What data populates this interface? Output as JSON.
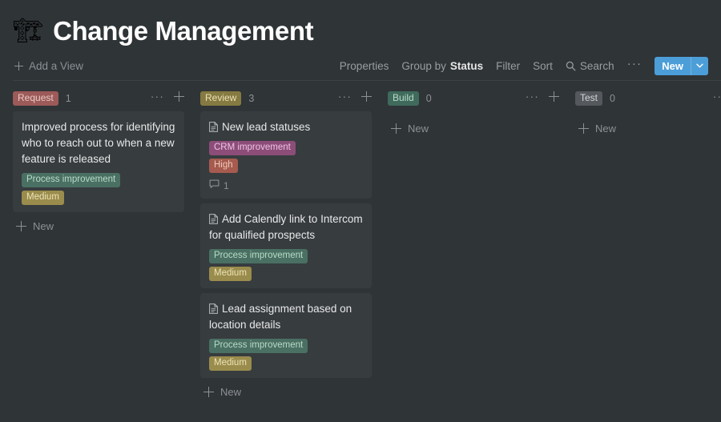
{
  "header": {
    "emoji": "🏗",
    "emoji_name": "crane-emoji",
    "title": "Change Management"
  },
  "toolbar": {
    "add_view_label": "Add a View",
    "properties_label": "Properties",
    "group_by_prefix": "Group by",
    "group_by_value": "Status",
    "filter_label": "Filter",
    "sort_label": "Sort",
    "search_label": "Search",
    "more_label": "···",
    "new_label": "New",
    "new_button_color": "#4c9ed9"
  },
  "board": {
    "columns": [
      {
        "name": "Request",
        "count": "1",
        "badge_bg": "#9c5a58",
        "badge_fg": "#e9c9c6",
        "new_label": "New",
        "cards": [
          {
            "title": "Improved process for identifying who to reach out to when a new feature is released",
            "has_doc_icon": false,
            "tags": [
              {
                "label": "Process improvement",
                "bg": "#4a7063",
                "fg": "#b9dbc9"
              },
              {
                "label": "Medium",
                "bg": "#9a8c4c",
                "fg": "#ece2b6"
              }
            ],
            "comments": ""
          }
        ]
      },
      {
        "name": "Review",
        "count": "3",
        "badge_bg": "#857a41",
        "badge_fg": "#ece2b6",
        "new_label": "New",
        "cards": [
          {
            "title": "New lead statuses",
            "has_doc_icon": true,
            "tags": [
              {
                "label": "CRM improvement",
                "bg": "#8c4d79",
                "fg": "#eec3e3"
              },
              {
                "label": "High",
                "bg": "#a65b4e",
                "fg": "#eec8bd"
              }
            ],
            "comments": "1"
          },
          {
            "title": "Add Calendly link to Intercom for qualified prospects",
            "has_doc_icon": true,
            "tags": [
              {
                "label": "Process improvement",
                "bg": "#4a7063",
                "fg": "#b9dbc9"
              },
              {
                "label": "Medium",
                "bg": "#9a8c4c",
                "fg": "#ece2b6"
              }
            ],
            "comments": ""
          },
          {
            "title": "Lead assignment based on location details",
            "has_doc_icon": true,
            "tags": [
              {
                "label": "Process improvement",
                "bg": "#4a7063",
                "fg": "#b9dbc9"
              },
              {
                "label": "Medium",
                "bg": "#9a8c4c",
                "fg": "#ece2b6"
              }
            ],
            "comments": ""
          }
        ]
      },
      {
        "name": "Build",
        "count": "0",
        "badge_bg": "#3f6a5c",
        "badge_fg": "#b9dbc9",
        "new_label": "New",
        "cards": []
      },
      {
        "name": "Test",
        "count": "0",
        "badge_bg": "#55585c",
        "badge_fg": "#d5d7d9",
        "new_label": "New",
        "cards": []
      }
    ]
  }
}
